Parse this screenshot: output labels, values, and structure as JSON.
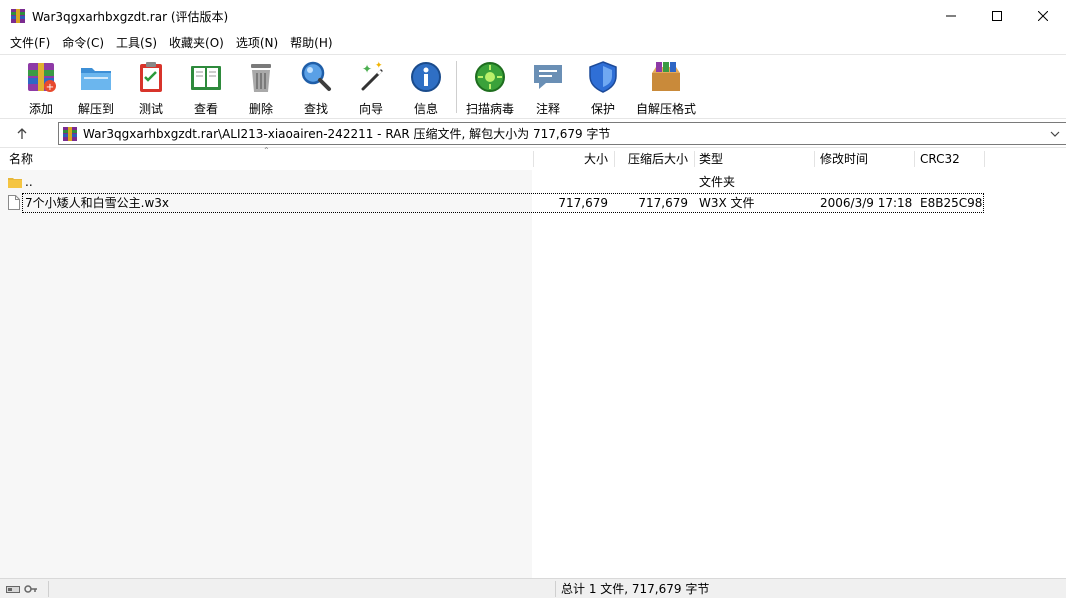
{
  "window": {
    "title": "War3qgxarhbxgzdt.rar (评估版本)"
  },
  "menu": [
    "文件(F)",
    "命令(C)",
    "工具(S)",
    "收藏夹(O)",
    "选项(N)",
    "帮助(H)"
  ],
  "toolbar": [
    {
      "label": "添加",
      "icon": "add-archive-icon"
    },
    {
      "label": "解压到",
      "icon": "extract-to-icon"
    },
    {
      "label": "测试",
      "icon": "test-icon"
    },
    {
      "label": "查看",
      "icon": "view-icon"
    },
    {
      "label": "删除",
      "icon": "delete-icon"
    },
    {
      "label": "查找",
      "icon": "find-icon"
    },
    {
      "label": "向导",
      "icon": "wizard-icon"
    },
    {
      "label": "信息",
      "icon": "info-icon"
    },
    {
      "label": "扫描病毒",
      "icon": "virus-scan-icon"
    },
    {
      "label": "注释",
      "icon": "comment-icon"
    },
    {
      "label": "保护",
      "icon": "protect-icon"
    },
    {
      "label": "自解压格式",
      "icon": "sfx-icon"
    }
  ],
  "address": {
    "path": "War3qgxarhbxgzdt.rar\\ALI213-xiaoairen-242211 - RAR 压缩文件, 解包大小为 717,679 字节"
  },
  "columns": {
    "name": "名称",
    "size": "大小",
    "packed": "压缩后大小",
    "type": "类型",
    "modified": "修改时间",
    "crc": "CRC32"
  },
  "rows": [
    {
      "name": "..",
      "size": "",
      "packed": "",
      "type": "文件夹",
      "modified": "",
      "crc": ""
    },
    {
      "name": "7个小矮人和白雪公主.w3x",
      "size": "717,679",
      "packed": "717,679",
      "type": "W3X 文件",
      "modified": "2006/3/9 17:18",
      "crc": "E8B25C98"
    }
  ],
  "status": {
    "summary": "总计 1 文件, 717,679 字节"
  },
  "colors": {
    "statusbar": "#f0f0f0",
    "name_column_shade": "#f7f7f7",
    "folder_yellow": "#f5c542"
  }
}
